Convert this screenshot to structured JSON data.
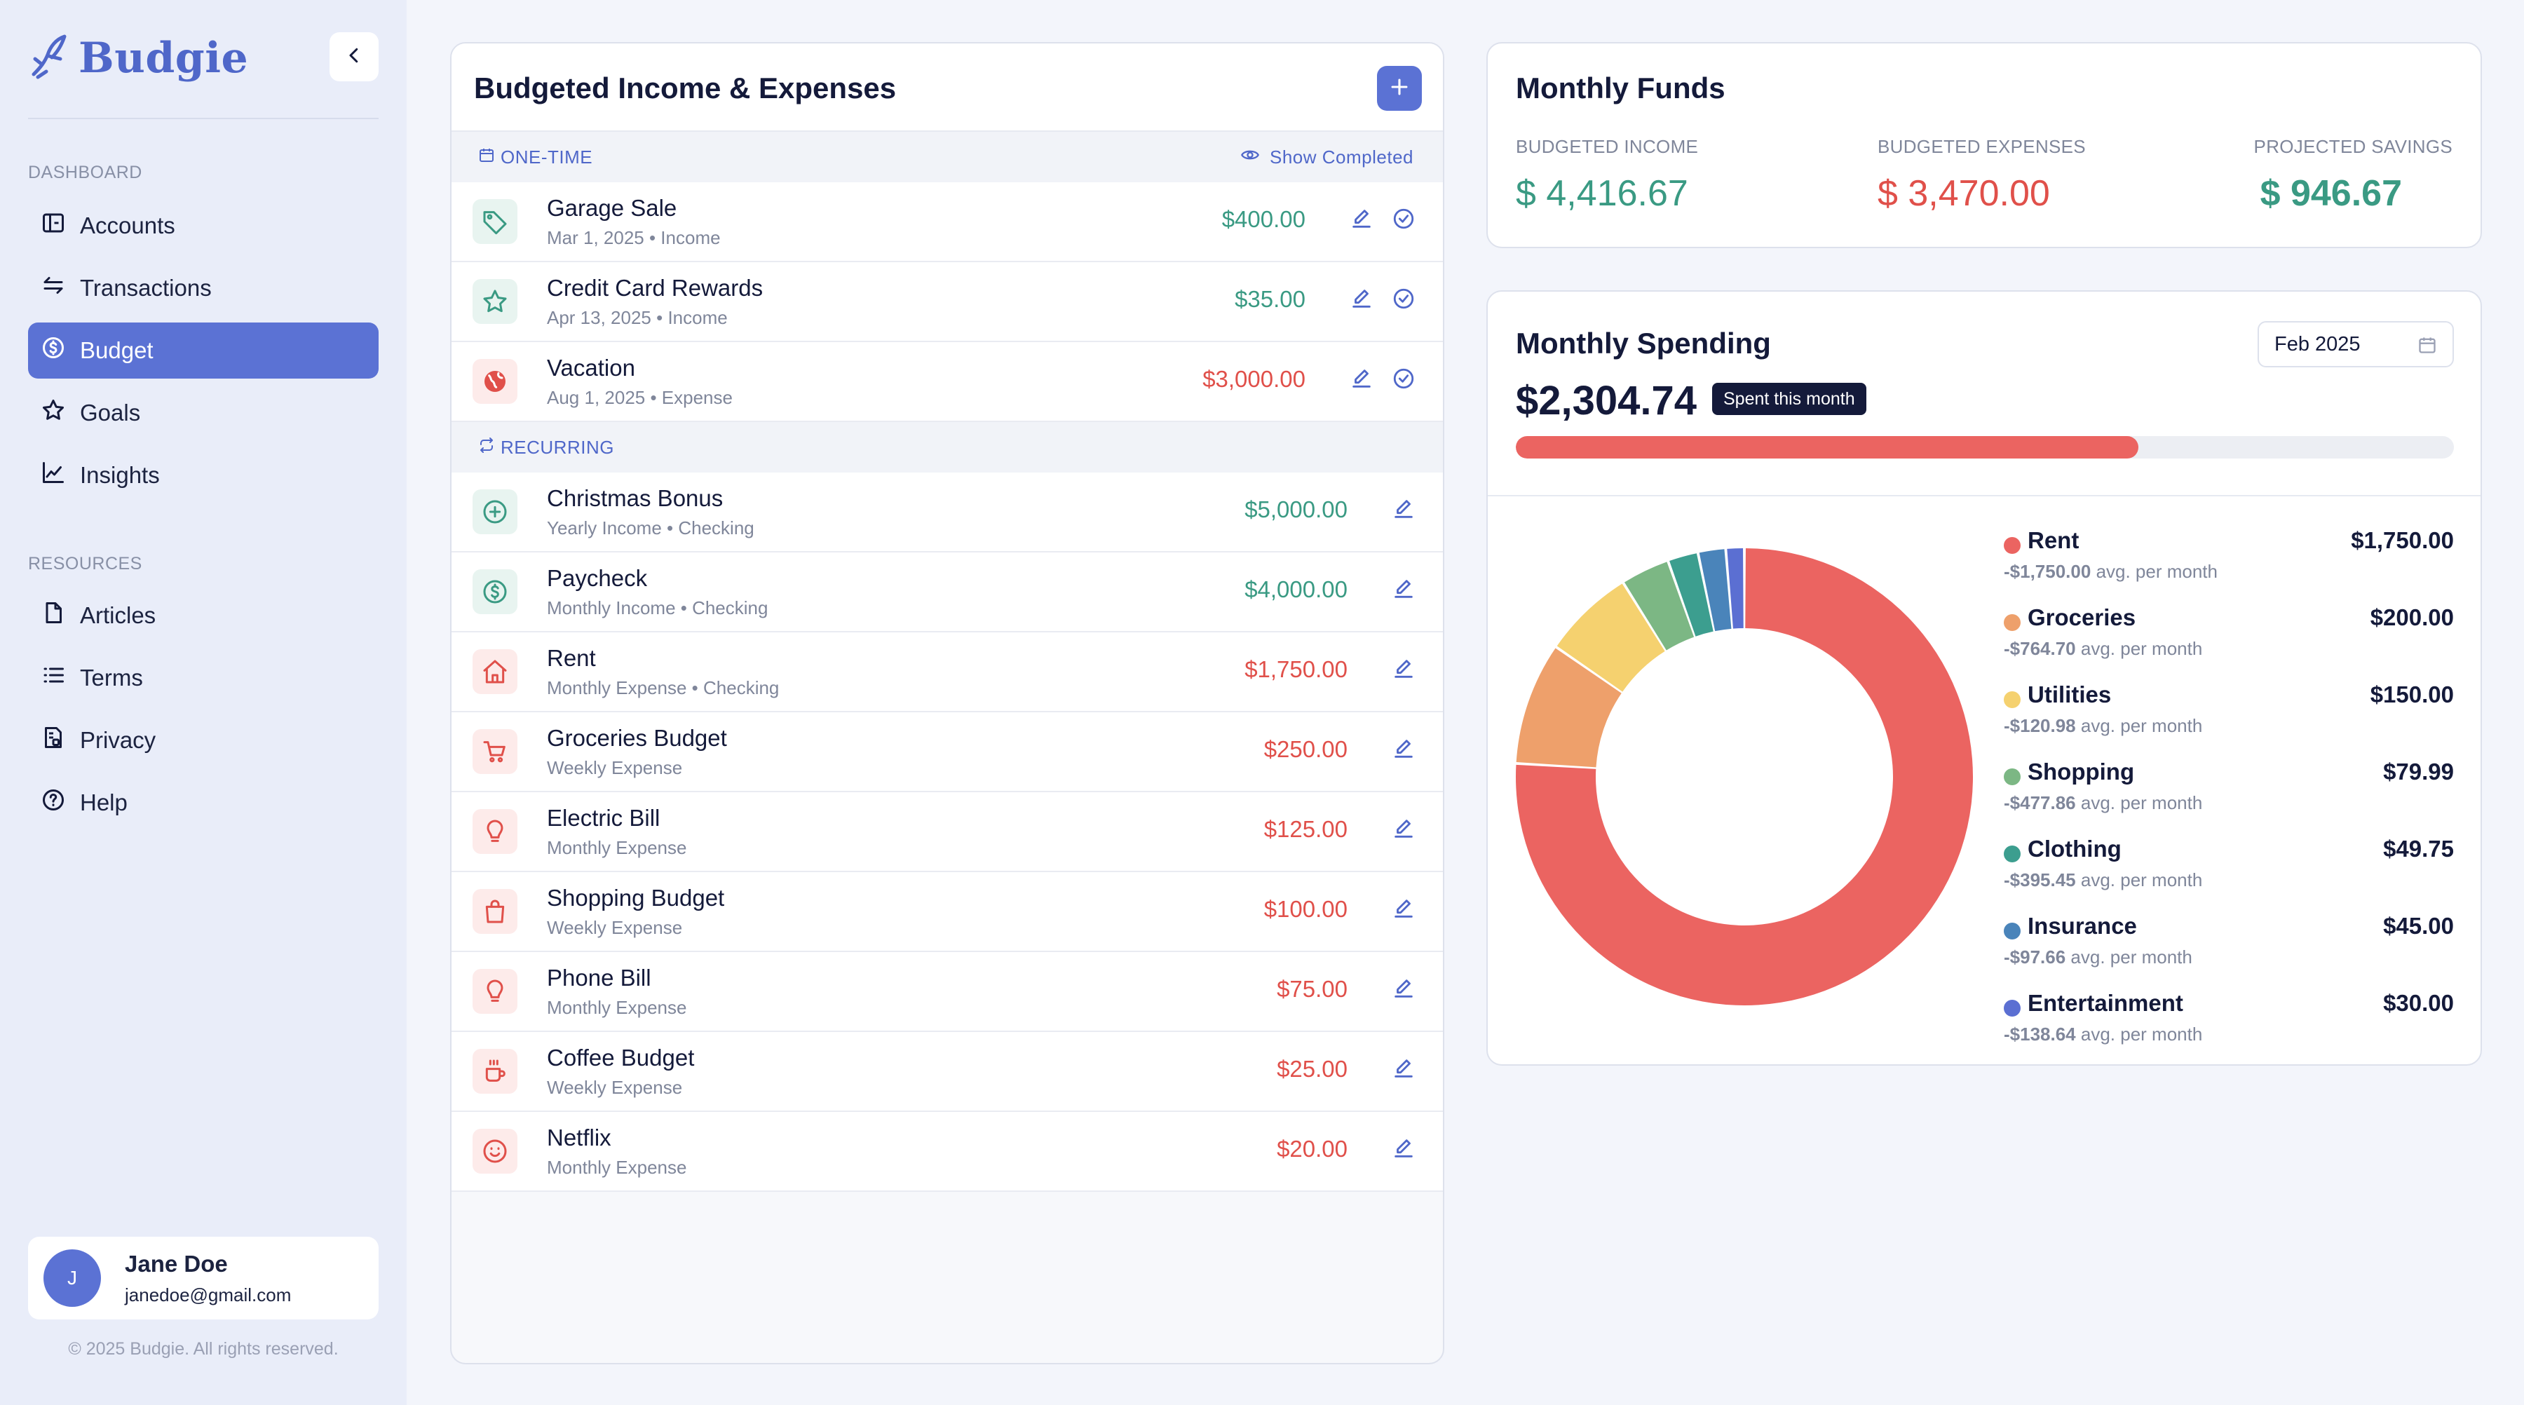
{
  "brand": {
    "name": "Budgie"
  },
  "sidebar": {
    "dashboard_label": "DASHBOARD",
    "dashboard_items": [
      {
        "label": "Accounts",
        "icon": "wallet-icon"
      },
      {
        "label": "Transactions",
        "icon": "arrows-exchange-icon"
      },
      {
        "label": "Budget",
        "icon": "dollar-circle-icon",
        "active": true
      },
      {
        "label": "Goals",
        "icon": "star-icon"
      },
      {
        "label": "Insights",
        "icon": "line-chart-icon"
      }
    ],
    "resources_label": "RESOURCES",
    "resource_items": [
      {
        "label": "Articles",
        "icon": "document-icon"
      },
      {
        "label": "Terms",
        "icon": "list-icon"
      },
      {
        "label": "Privacy",
        "icon": "privacy-document-icon"
      },
      {
        "label": "Help",
        "icon": "help-circle-icon"
      }
    ],
    "user": {
      "initial": "J",
      "name": "Jane Doe",
      "email": "janedoe@gmail.com"
    },
    "copyright": "© 2025 Budgie. All rights reserved."
  },
  "budget": {
    "title": "Budgeted Income & Expenses",
    "one_time_label": "ONE-TIME",
    "show_completed_label": "Show Completed",
    "recurring_label": "RECURRING",
    "one_time": [
      {
        "name": "Garage Sale",
        "sub": "Mar 1, 2025 • Income",
        "amount": "$400.00",
        "kind": "inc",
        "icon": "tag-icon"
      },
      {
        "name": "Credit Card Rewards",
        "sub": "Apr 13, 2025 • Income",
        "amount": "$35.00",
        "kind": "inc",
        "icon": "star-icon"
      },
      {
        "name": "Vacation",
        "sub": "Aug 1, 2025 • Expense",
        "amount": "$3,000.00",
        "kind": "exp",
        "icon": "globe-icon"
      }
    ],
    "recurring": [
      {
        "name": "Christmas Bonus",
        "sub": "Yearly Income • Checking",
        "amount": "$5,000.00",
        "kind": "inc",
        "icon": "plus-circle-icon"
      },
      {
        "name": "Paycheck",
        "sub": "Monthly Income • Checking",
        "amount": "$4,000.00",
        "kind": "inc",
        "icon": "dollar-circle-icon"
      },
      {
        "name": "Rent",
        "sub": "Monthly Expense • Checking",
        "amount": "$1,750.00",
        "kind": "exp",
        "icon": "home-icon"
      },
      {
        "name": "Groceries Budget",
        "sub": "Weekly Expense",
        "amount": "$250.00",
        "kind": "exp",
        "icon": "cart-icon"
      },
      {
        "name": "Electric Bill",
        "sub": "Monthly Expense",
        "amount": "$125.00",
        "kind": "exp",
        "icon": "lightbulb-icon"
      },
      {
        "name": "Shopping Budget",
        "sub": "Weekly Expense",
        "amount": "$100.00",
        "kind": "exp",
        "icon": "shopping-bag-icon"
      },
      {
        "name": "Phone Bill",
        "sub": "Monthly Expense",
        "amount": "$75.00",
        "kind": "exp",
        "icon": "lightbulb-icon"
      },
      {
        "name": "Coffee Budget",
        "sub": "Weekly Expense",
        "amount": "$25.00",
        "kind": "exp",
        "icon": "coffee-icon"
      },
      {
        "name": "Netflix",
        "sub": "Monthly Expense",
        "amount": "$20.00",
        "kind": "exp",
        "icon": "smile-icon"
      }
    ]
  },
  "funds": {
    "title": "Monthly Funds",
    "income_label": "BUDGETED INCOME",
    "income_value": "$ 4,416.67",
    "expenses_label": "BUDGETED EXPENSES",
    "expenses_value": "$ 3,470.00",
    "savings_label": "PROJECTED SAVINGS",
    "savings_value": "$ 946.67"
  },
  "spending": {
    "title": "Monthly Spending",
    "month": "Feb 2025",
    "amount": "$2,304.74",
    "badge": "Spent this month",
    "progress_fraction": 0.664,
    "avg_suffix": "avg. per month",
    "categories": [
      {
        "name": "Rent",
        "amount": "$1,750.00",
        "avg": "-$1,750.00",
        "value": 1750.0,
        "color": "#eb6461"
      },
      {
        "name": "Groceries",
        "amount": "$200.00",
        "avg": "-$764.70",
        "value": 200.0,
        "color": "#eea06b"
      },
      {
        "name": "Utilities",
        "amount": "$150.00",
        "avg": "-$120.98",
        "value": 150.0,
        "color": "#f5d16f"
      },
      {
        "name": "Shopping",
        "amount": "$79.99",
        "avg": "-$477.86",
        "value": 79.99,
        "color": "#7cb784"
      },
      {
        "name": "Clothing",
        "amount": "$49.75",
        "avg": "-$395.45",
        "value": 49.75,
        "color": "#3c9e8f"
      },
      {
        "name": "Insurance",
        "amount": "$45.00",
        "avg": "-$97.66",
        "value": 45.0,
        "color": "#4a84ba"
      },
      {
        "name": "Entertainment",
        "amount": "$30.00",
        "avg": "-$138.64",
        "value": 30.0,
        "color": "#5b6fd2"
      }
    ]
  }
}
